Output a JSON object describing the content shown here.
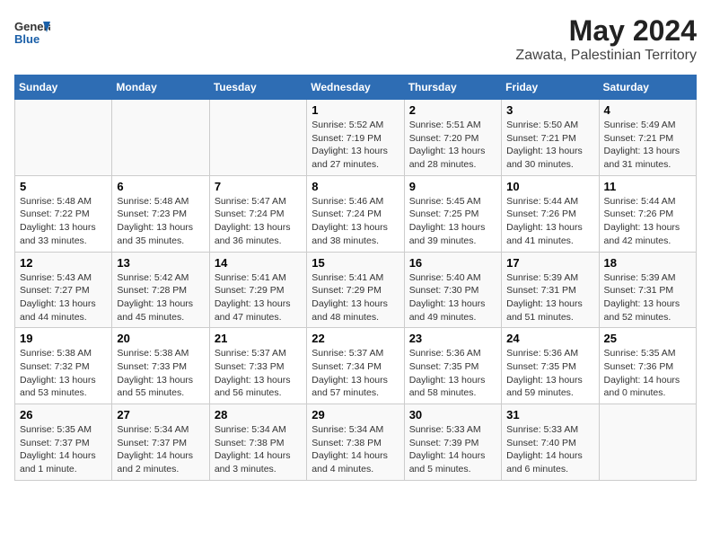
{
  "header": {
    "logo_general": "General",
    "logo_blue": "Blue",
    "title": "May 2024",
    "subtitle": "Zawata, Palestinian Territory"
  },
  "days_of_week": [
    "Sunday",
    "Monday",
    "Tuesday",
    "Wednesday",
    "Thursday",
    "Friday",
    "Saturday"
  ],
  "weeks": [
    [
      {
        "day": "",
        "info": ""
      },
      {
        "day": "",
        "info": ""
      },
      {
        "day": "",
        "info": ""
      },
      {
        "day": "1",
        "info": "Sunrise: 5:52 AM\nSunset: 7:19 PM\nDaylight: 13 hours and 27 minutes."
      },
      {
        "day": "2",
        "info": "Sunrise: 5:51 AM\nSunset: 7:20 PM\nDaylight: 13 hours and 28 minutes."
      },
      {
        "day": "3",
        "info": "Sunrise: 5:50 AM\nSunset: 7:21 PM\nDaylight: 13 hours and 30 minutes."
      },
      {
        "day": "4",
        "info": "Sunrise: 5:49 AM\nSunset: 7:21 PM\nDaylight: 13 hours and 31 minutes."
      }
    ],
    [
      {
        "day": "5",
        "info": "Sunrise: 5:48 AM\nSunset: 7:22 PM\nDaylight: 13 hours and 33 minutes."
      },
      {
        "day": "6",
        "info": "Sunrise: 5:48 AM\nSunset: 7:23 PM\nDaylight: 13 hours and 35 minutes."
      },
      {
        "day": "7",
        "info": "Sunrise: 5:47 AM\nSunset: 7:24 PM\nDaylight: 13 hours and 36 minutes."
      },
      {
        "day": "8",
        "info": "Sunrise: 5:46 AM\nSunset: 7:24 PM\nDaylight: 13 hours and 38 minutes."
      },
      {
        "day": "9",
        "info": "Sunrise: 5:45 AM\nSunset: 7:25 PM\nDaylight: 13 hours and 39 minutes."
      },
      {
        "day": "10",
        "info": "Sunrise: 5:44 AM\nSunset: 7:26 PM\nDaylight: 13 hours and 41 minutes."
      },
      {
        "day": "11",
        "info": "Sunrise: 5:44 AM\nSunset: 7:26 PM\nDaylight: 13 hours and 42 minutes."
      }
    ],
    [
      {
        "day": "12",
        "info": "Sunrise: 5:43 AM\nSunset: 7:27 PM\nDaylight: 13 hours and 44 minutes."
      },
      {
        "day": "13",
        "info": "Sunrise: 5:42 AM\nSunset: 7:28 PM\nDaylight: 13 hours and 45 minutes."
      },
      {
        "day": "14",
        "info": "Sunrise: 5:41 AM\nSunset: 7:29 PM\nDaylight: 13 hours and 47 minutes."
      },
      {
        "day": "15",
        "info": "Sunrise: 5:41 AM\nSunset: 7:29 PM\nDaylight: 13 hours and 48 minutes."
      },
      {
        "day": "16",
        "info": "Sunrise: 5:40 AM\nSunset: 7:30 PM\nDaylight: 13 hours and 49 minutes."
      },
      {
        "day": "17",
        "info": "Sunrise: 5:39 AM\nSunset: 7:31 PM\nDaylight: 13 hours and 51 minutes."
      },
      {
        "day": "18",
        "info": "Sunrise: 5:39 AM\nSunset: 7:31 PM\nDaylight: 13 hours and 52 minutes."
      }
    ],
    [
      {
        "day": "19",
        "info": "Sunrise: 5:38 AM\nSunset: 7:32 PM\nDaylight: 13 hours and 53 minutes."
      },
      {
        "day": "20",
        "info": "Sunrise: 5:38 AM\nSunset: 7:33 PM\nDaylight: 13 hours and 55 minutes."
      },
      {
        "day": "21",
        "info": "Sunrise: 5:37 AM\nSunset: 7:33 PM\nDaylight: 13 hours and 56 minutes."
      },
      {
        "day": "22",
        "info": "Sunrise: 5:37 AM\nSunset: 7:34 PM\nDaylight: 13 hours and 57 minutes."
      },
      {
        "day": "23",
        "info": "Sunrise: 5:36 AM\nSunset: 7:35 PM\nDaylight: 13 hours and 58 minutes."
      },
      {
        "day": "24",
        "info": "Sunrise: 5:36 AM\nSunset: 7:35 PM\nDaylight: 13 hours and 59 minutes."
      },
      {
        "day": "25",
        "info": "Sunrise: 5:35 AM\nSunset: 7:36 PM\nDaylight: 14 hours and 0 minutes."
      }
    ],
    [
      {
        "day": "26",
        "info": "Sunrise: 5:35 AM\nSunset: 7:37 PM\nDaylight: 14 hours and 1 minute."
      },
      {
        "day": "27",
        "info": "Sunrise: 5:34 AM\nSunset: 7:37 PM\nDaylight: 14 hours and 2 minutes."
      },
      {
        "day": "28",
        "info": "Sunrise: 5:34 AM\nSunset: 7:38 PM\nDaylight: 14 hours and 3 minutes."
      },
      {
        "day": "29",
        "info": "Sunrise: 5:34 AM\nSunset: 7:38 PM\nDaylight: 14 hours and 4 minutes."
      },
      {
        "day": "30",
        "info": "Sunrise: 5:33 AM\nSunset: 7:39 PM\nDaylight: 14 hours and 5 minutes."
      },
      {
        "day": "31",
        "info": "Sunrise: 5:33 AM\nSunset: 7:40 PM\nDaylight: 14 hours and 6 minutes."
      },
      {
        "day": "",
        "info": ""
      }
    ]
  ]
}
